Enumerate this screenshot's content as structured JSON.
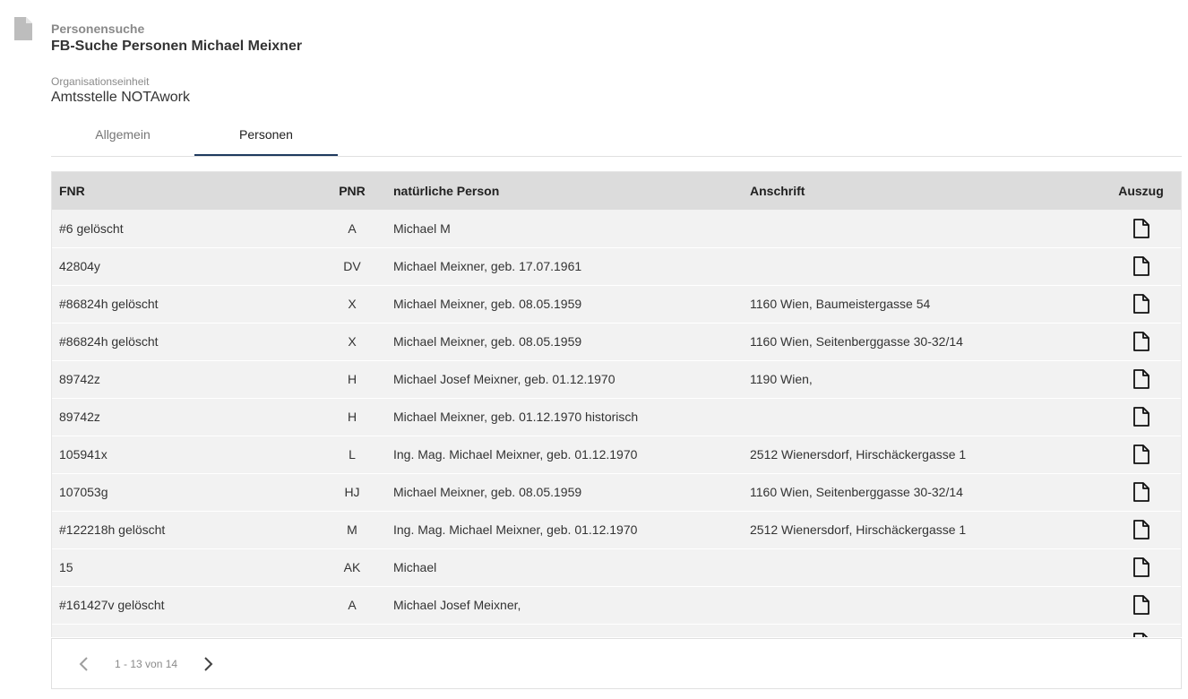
{
  "header": {
    "section": "Personensuche",
    "title": "FB-Suche Personen Michael Meixner",
    "icon": "document-icon"
  },
  "org": {
    "label": "Organisationseinheit",
    "value": "Amtsstelle NOTAwork"
  },
  "tabs": [
    {
      "label": "Allgemein",
      "active": false
    },
    {
      "label": "Personen",
      "active": true
    }
  ],
  "table": {
    "columns": [
      "FNR",
      "PNR",
      "natürliche Person",
      "Anschrift",
      "Auszug"
    ],
    "rows": [
      {
        "fnr": "#6   gelöscht",
        "pnr": "A",
        "person": "Michael M",
        "address": ""
      },
      {
        "fnr": "42804y",
        "pnr": "DV",
        "person": "Michael Meixner, geb. 17.07.1961",
        "address": ""
      },
      {
        "fnr": "#86824h gelöscht",
        "pnr": "X",
        "person": "Michael Meixner, geb. 08.05.1959",
        "address": "1160 Wien, Baumeistergasse 54"
      },
      {
        "fnr": "#86824h gelöscht",
        "pnr": "X",
        "person": "Michael Meixner, geb. 08.05.1959",
        "address": "1160 Wien, Seitenberggasse 30-32/14"
      },
      {
        "fnr": "89742z",
        "pnr": "H",
        "person": "Michael Josef Meixner, geb. 01.12.1970",
        "address": "1190 Wien,"
      },
      {
        "fnr": "89742z",
        "pnr": "H",
        "person": "Michael Meixner, geb. 01.12.1970 historisch",
        "address": ""
      },
      {
        "fnr": "105941x",
        "pnr": "L",
        "person": "Ing. Mag. Michael Meixner, geb. 01.12.1970",
        "address": "2512 Wienersdorf, Hirschäckergasse 1"
      },
      {
        "fnr": "107053g",
        "pnr": "HJ",
        "person": "Michael Meixner, geb. 08.05.1959",
        "address": "1160 Wien, Seitenberggasse 30-32/14"
      },
      {
        "fnr": "#122218h gelöscht",
        "pnr": "M",
        "person": "Ing. Mag. Michael Meixner, geb. 01.12.1970",
        "address": "2512 Wienersdorf, Hirschäckergasse 1"
      },
      {
        "fnr": "15",
        "pnr": "AK",
        "person": "Michael",
        "address": ""
      },
      {
        "fnr": "#161427v gelöscht",
        "pnr": "A",
        "person": "Michael Josef Meixner,",
        "address": ""
      },
      {
        "fnr": "",
        "pnr": "",
        "person": "",
        "address": ""
      }
    ]
  },
  "pagination": {
    "range_text": "1 - 13 von 14"
  },
  "colors": {
    "tab_indicator": "#1f3a5f",
    "header_bg": "#dcdcdc",
    "row_bg": "#f2f2f2"
  }
}
